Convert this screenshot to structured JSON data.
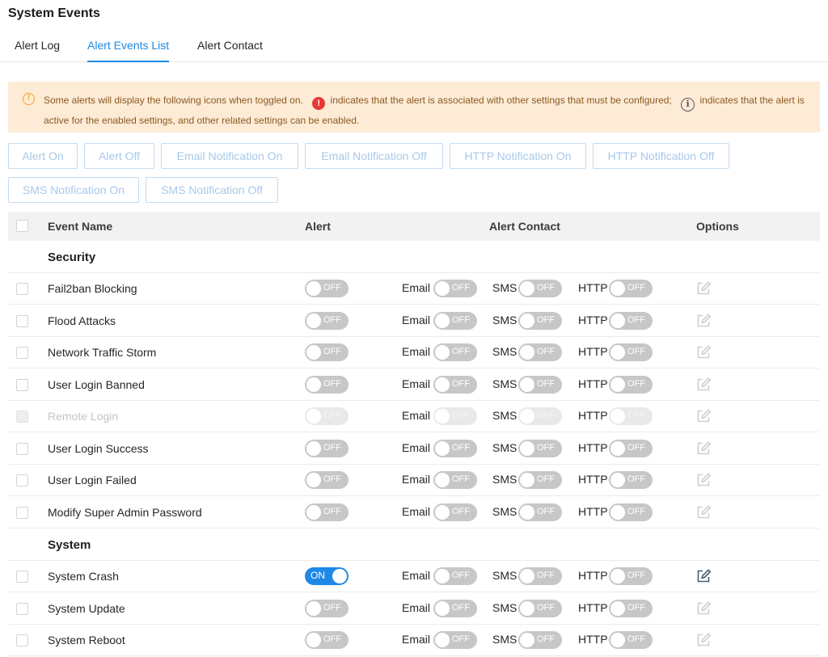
{
  "page": {
    "title": "System Events"
  },
  "tabs": [
    {
      "label": "Alert Log"
    },
    {
      "label": "Alert Events List"
    },
    {
      "label": "Alert Contact"
    }
  ],
  "notice": {
    "icon": "warning-circle-icon",
    "text1": "Some alerts will display the following icons when toggled on.",
    "text2": "indicates that the alert is associated with other settings that must be configured;",
    "text3": "indicates that the alert is active for the enabled settings, and other related settings can be enabled.",
    "red_icon_glyph": "!",
    "info_icon_glyph": "i",
    "colors": {
      "background": "#fdebd6",
      "text": "#8a5a22",
      "warn": "#f39c2a",
      "error": "#e53935"
    }
  },
  "actions": [
    "Alert On",
    "Alert Off",
    "Email Notification On",
    "Email Notification Off",
    "HTTP Notification On",
    "HTTP Notification Off",
    "SMS Notification On",
    "SMS Notification Off"
  ],
  "table": {
    "columns": {
      "event_name": "Event Name",
      "alert": "Alert",
      "alert_contact": "Alert Contact",
      "options": "Options"
    },
    "contact_labels": {
      "email": "Email",
      "sms": "SMS",
      "http": "HTTP"
    },
    "toggle_labels": {
      "on": "ON",
      "off": "OFF"
    },
    "groups": [
      {
        "name": "Security",
        "events": [
          {
            "name": "Fail2ban Blocking",
            "alert": false,
            "email": false,
            "sms": false,
            "http": false,
            "disabled": false
          },
          {
            "name": "Flood Attacks",
            "alert": false,
            "email": false,
            "sms": false,
            "http": false,
            "disabled": false
          },
          {
            "name": "Network Traffic Storm",
            "alert": false,
            "email": false,
            "sms": false,
            "http": false,
            "disabled": false
          },
          {
            "name": "User Login Banned",
            "alert": false,
            "email": false,
            "sms": false,
            "http": false,
            "disabled": false
          },
          {
            "name": "Remote Login",
            "alert": false,
            "email": false,
            "sms": false,
            "http": false,
            "disabled": true
          },
          {
            "name": "User Login Success",
            "alert": false,
            "email": false,
            "sms": false,
            "http": false,
            "disabled": false
          },
          {
            "name": "User Login Failed",
            "alert": false,
            "email": false,
            "sms": false,
            "http": false,
            "disabled": false
          },
          {
            "name": "Modify Super Admin Password",
            "alert": false,
            "email": false,
            "sms": false,
            "http": false,
            "disabled": false
          }
        ]
      },
      {
        "name": "System",
        "events": [
          {
            "name": "System Crash",
            "alert": true,
            "email": false,
            "sms": false,
            "http": false,
            "disabled": false
          },
          {
            "name": "System Update",
            "alert": false,
            "email": false,
            "sms": false,
            "http": false,
            "disabled": false
          },
          {
            "name": "System Reboot",
            "alert": false,
            "email": false,
            "sms": false,
            "http": false,
            "disabled": false
          }
        ]
      }
    ]
  },
  "colors": {
    "accent": "#1e88e5",
    "toggle_off": "#c7c7c7",
    "header_bg": "#f2f2f2",
    "button_border": "#c3dcf2",
    "button_text": "#a7c9ea",
    "edit_icon_active": "#4a5a70",
    "edit_icon_inactive": "#cfcfcf"
  }
}
